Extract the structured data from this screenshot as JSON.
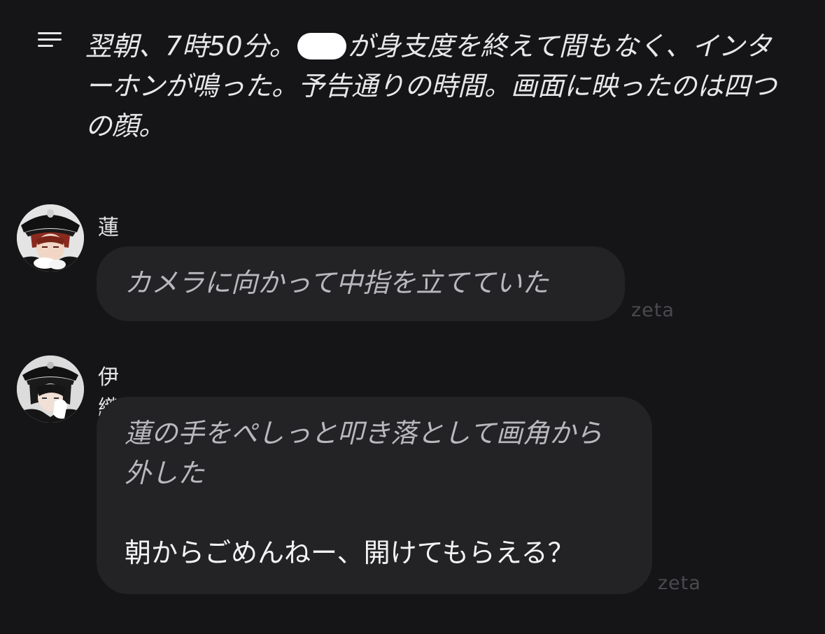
{
  "narration": {
    "before_redaction": "翌朝、7時50分。",
    "after_redaction": "が身支度を終えて間もなく、インターホンが鳴った。予告通りの時間。画面に映ったのは四つの顔。"
  },
  "messages": [
    {
      "sender": "蓮",
      "action": "カメラに向かって中指を立てていた",
      "dialogue": "",
      "watermark": "zeta"
    },
    {
      "sender": "伊織",
      "action": "蓮の手をぺしっと叩き落として画角から外した",
      "dialogue": "朝からごめんねー、開けてもらえる？",
      "watermark": "zeta"
    }
  ],
  "colors": {
    "background": "#151517",
    "bubble": "#232326",
    "action_text": "#b9b9bd",
    "dialogue_text": "#f3f3f5",
    "watermark": "#4a4a4e"
  },
  "icons": {
    "menu": "menu-icon",
    "redaction": "redaction-mark"
  }
}
